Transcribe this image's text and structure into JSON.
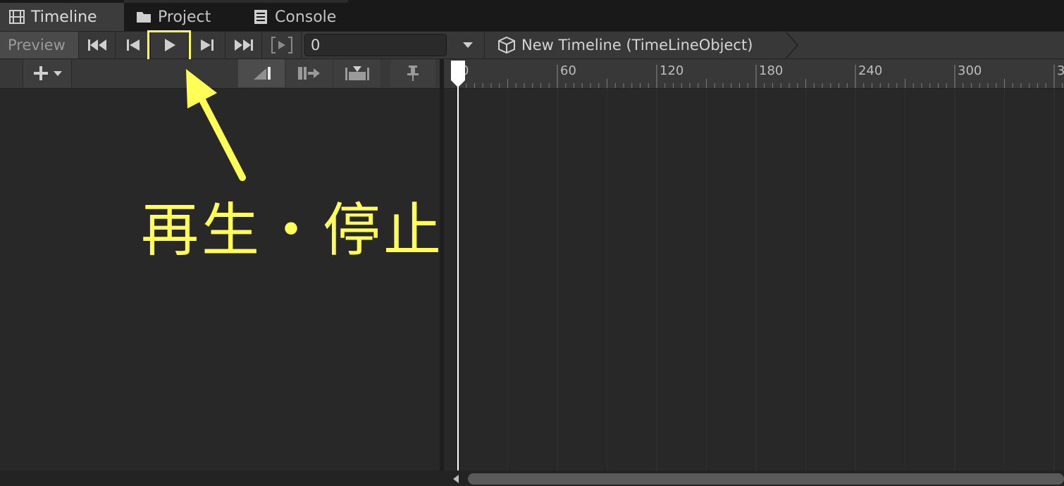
{
  "tabs": [
    {
      "label": "Timeline",
      "icon": "film-icon",
      "active": true
    },
    {
      "label": "Project",
      "icon": "folder-icon",
      "active": false
    },
    {
      "label": "Console",
      "icon": "console-icon",
      "active": false
    }
  ],
  "toolbar": {
    "preview_label": "Preview",
    "buttons": [
      "go-to-start-icon",
      "previous-frame-icon",
      "play-icon",
      "next-frame-icon",
      "go-to-end-icon",
      "play-range-icon"
    ],
    "frame_value": "0",
    "breadcrumb_icon": "cube-icon",
    "breadcrumb_label": "New Timeline (TimeLineObject)"
  },
  "track_toolbar": {
    "buttons": [
      "add-track-icon",
      "ripple-edit-icon",
      "replace-edit-icon",
      "mix-edit-icon",
      "pin-icon"
    ]
  },
  "ruler": {
    "labels": [
      "0",
      "60",
      "120",
      "180",
      "240",
      "300",
      "3"
    ]
  },
  "annotation": {
    "text": "再生・停止",
    "color": "#ffff55"
  },
  "colors": {
    "background": "#282828",
    "toolbar": "#383838",
    "accent": "#ffff55",
    "playhead": "#ffffff"
  }
}
